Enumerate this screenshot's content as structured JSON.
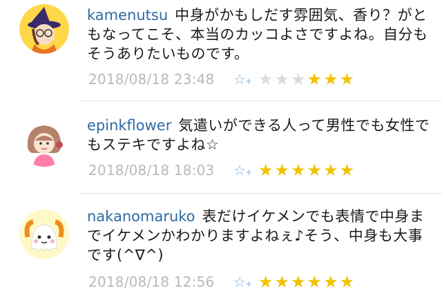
{
  "comments": [
    {
      "username": "kamenutsu",
      "text": "中身がかもしだす雰囲気、香り？がともなってこそ、本当のカッコよさですよね。自分もそうありたいものです。",
      "date": "2018/08/18 23:48",
      "stars_gray": 3,
      "stars_yellow": 3,
      "avatar_icon": "witch-avatar-icon"
    },
    {
      "username": "epinkflower",
      "text": "気遣いができる人って男性でも女性でもステキですよね☆",
      "date": "2018/08/18 18:03",
      "stars_gray": 0,
      "stars_yellow": 6,
      "avatar_icon": "girl-avatar-icon"
    },
    {
      "username": "nakanomaruko",
      "text": "表だけイケメンでも表情で中身までイケメンかわかりますよねぇ♪そう、中身も大事です(^∇^)",
      "date": "2018/08/18 12:56",
      "stars_gray": 0,
      "stars_yellow": 6,
      "avatar_icon": "maru-ghost-avatar-icon"
    }
  ],
  "add_star_icon": "add-star-icon",
  "colors": {
    "username": "#2e6aa6",
    "star_on": "#f2c200",
    "star_off": "#dcdcdc",
    "date": "#b9b9b9"
  }
}
